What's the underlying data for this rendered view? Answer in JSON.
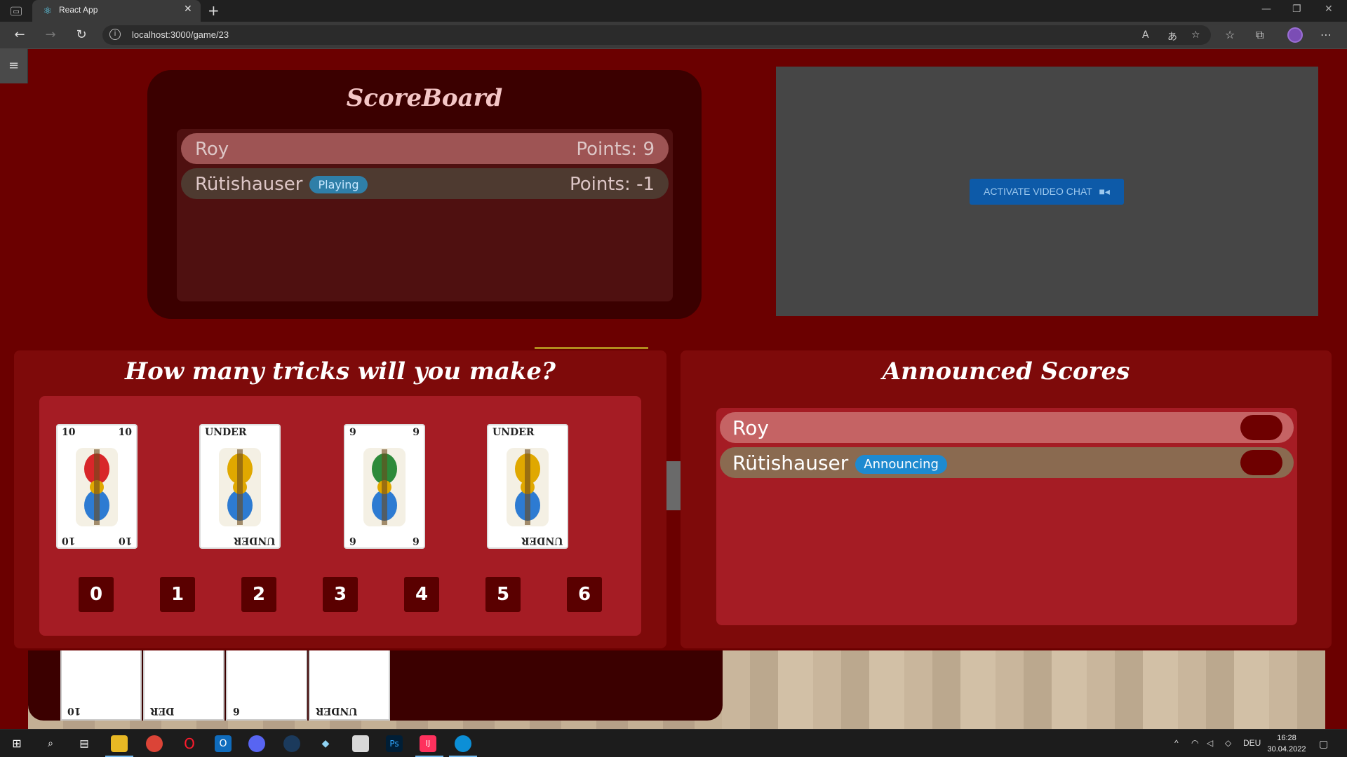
{
  "browser": {
    "tab_title": "React App",
    "url": "localhost:3000/game/23",
    "new_tab": "+",
    "close_tab": "✕"
  },
  "page": {
    "menu_icon": "≡",
    "scoreboard": {
      "title": "ScoreBoard",
      "players": [
        {
          "name": "Roy",
          "points": "Points: 9",
          "badge": ""
        },
        {
          "name": "Rütishauser",
          "points": "Points: -1",
          "badge": "Playing"
        }
      ]
    },
    "video": {
      "button_label": "ACTIVATE VIDEO CHAT"
    },
    "tricks": {
      "title": "How many tricks will you make?",
      "cards": [
        {
          "tl": "10",
          "tr": "10",
          "bl": "10",
          "br": "10",
          "name": "Banner (10) of Acorns",
          "accent": "#d8262a"
        },
        {
          "tl": "UNDER",
          "tr": "",
          "bl": "",
          "br": "UNDER",
          "name": "Under of Bells",
          "accent": "#e0a800"
        },
        {
          "tl": "9",
          "tr": "9",
          "bl": "6",
          "br": "6",
          "name": "Nine of Acorns",
          "accent": "#2d8a3a"
        },
        {
          "tl": "UNDER",
          "tr": "",
          "bl": "",
          "br": "UNDER",
          "name": "Under of Acorns",
          "accent": "#e0a800"
        }
      ],
      "options": [
        "0",
        "1",
        "2",
        "3",
        "4",
        "5",
        "6"
      ]
    },
    "announced": {
      "title": "Announced Scores",
      "players": [
        {
          "name": "Roy",
          "badge": ""
        },
        {
          "name": "Rütishauser",
          "badge": "Announcing"
        }
      ]
    },
    "hand": [
      {
        "label": "10"
      },
      {
        "label": "DER"
      },
      {
        "label": "6"
      },
      {
        "label": "UNDER"
      }
    ]
  },
  "taskbar": {
    "lang": "DEU",
    "time": "16:28",
    "date": "30.04.2022"
  },
  "colors": {
    "page_bg": "#6b0000",
    "panel_bg": "#7e0a0a",
    "inner_bg": "#a51c24",
    "badge_blue": "#2f7fa8",
    "video_button": "#0d5aa8"
  }
}
